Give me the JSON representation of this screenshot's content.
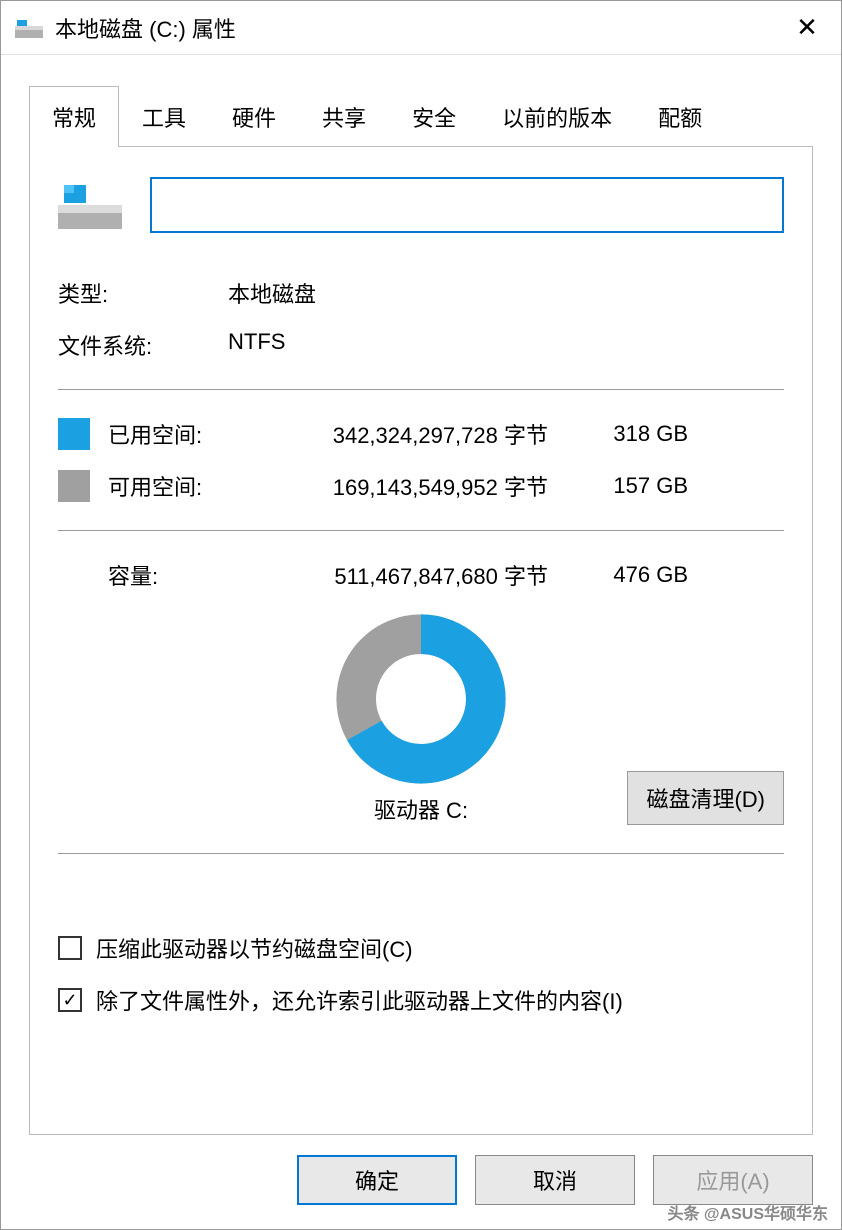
{
  "titlebar": {
    "title": "本地磁盘 (C:) 属性"
  },
  "tabs": [
    "常规",
    "工具",
    "硬件",
    "共享",
    "安全",
    "以前的版本",
    "配额"
  ],
  "active_tab": 0,
  "general": {
    "name_value": "",
    "type_label": "类型:",
    "type_value": "本地磁盘",
    "fs_label": "文件系统:",
    "fs_value": "NTFS",
    "used_label": "已用空间:",
    "used_bytes": "342,324,297,728 字节",
    "used_gb": "318 GB",
    "free_label": "可用空间:",
    "free_bytes": "169,143,549,952 字节",
    "free_gb": "157 GB",
    "capacity_label": "容量:",
    "capacity_bytes": "511,467,847,680 字节",
    "capacity_gb": "476 GB",
    "drive_label": "驱动器 C:",
    "cleanup_button": "磁盘清理(D)",
    "checkbox_compress": "压缩此驱动器以节约磁盘空间(C)",
    "checkbox_index": "除了文件属性外，还允许索引此驱动器上文件的内容(I)",
    "compress_checked": false,
    "index_checked": true
  },
  "footer": {
    "ok": "确定",
    "cancel": "取消",
    "apply": "应用(A)"
  },
  "colors": {
    "used": "#1ba1e2",
    "free": "#a0a0a0",
    "accent": "#0078d4"
  },
  "watermark": "头条 @ASUS华硕华东",
  "chart_data": {
    "type": "pie",
    "title": "驱动器 C:",
    "series": [
      {
        "name": "已用空间",
        "value": 318,
        "unit": "GB",
        "color": "#1ba1e2"
      },
      {
        "name": "可用空间",
        "value": 157,
        "unit": "GB",
        "color": "#a0a0a0"
      }
    ]
  }
}
